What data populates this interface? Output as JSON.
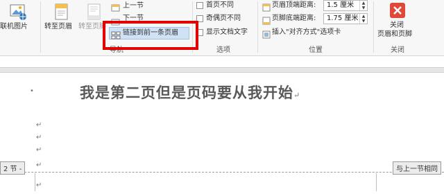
{
  "ribbon": {
    "insert_group": {
      "online_picture": "联机图片"
    },
    "nav_group": {
      "goto_header": "转至页眉",
      "goto_footer": "转至页脚",
      "prev_section": "上一节",
      "next_section": "下一节",
      "link_to_previous": "链接到前一条页眉",
      "label": "导航"
    },
    "options_group": {
      "diff_first_page": "首页不同",
      "diff_odd_even": "奇偶页不同",
      "show_doc_text": "显示文档文字",
      "label": "选项"
    },
    "position_group": {
      "header_from_top": "页眉顶端距离:",
      "header_from_top_value": "1.5 厘米",
      "footer_from_bottom": "页脚底端距离:",
      "footer_from_bottom_value": "1.75 厘米",
      "insert_align_tab": "插入\"对齐方式\"选项卡",
      "label": "位置"
    },
    "close_group": {
      "close_line1": "关闭",
      "close_line2": "页眉和页脚",
      "label": "关闭"
    }
  },
  "document": {
    "heading": "我是第二页但是页码要从我开始",
    "footer_section_tag": "2 节 -",
    "same_as_previous_tag": "与上一节相同",
    "para_mark": "↵",
    "bullet": "•"
  },
  "colors": {
    "highlight_red": "#e00000",
    "close_icon_red": "#e0493a",
    "selected_button_bg": "#cfe2f6"
  }
}
